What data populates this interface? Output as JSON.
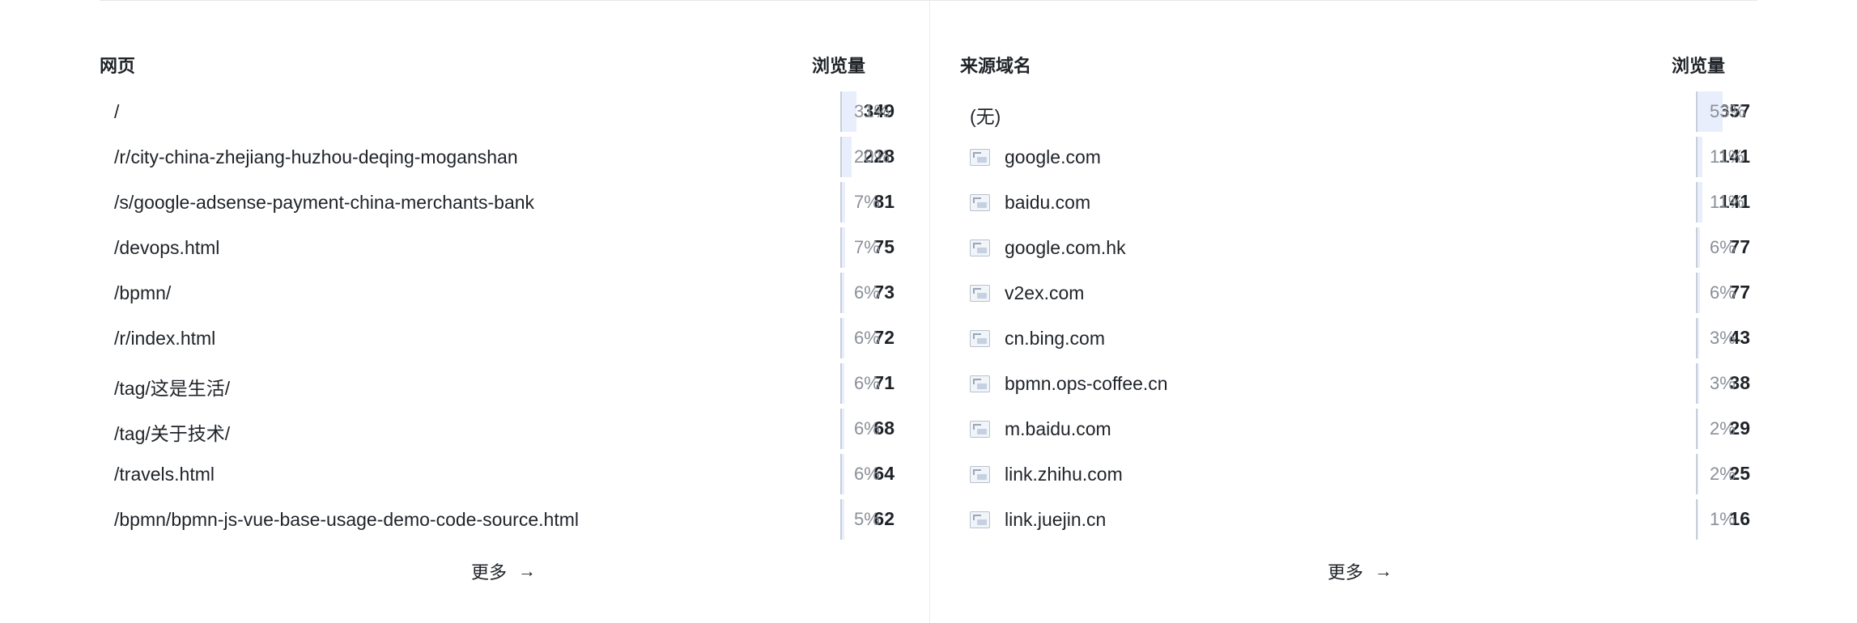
{
  "pages": {
    "title": "网页",
    "views_label": "浏览量",
    "more_label": "更多",
    "rows": [
      {
        "label": "/",
        "count": "349",
        "pct": "31%",
        "share": 0.31
      },
      {
        "label": "/r/city-china-zhejiang-huzhou-deqing-moganshan",
        "count": "228",
        "pct": "20%",
        "share": 0.2
      },
      {
        "label": "/s/google-adsense-payment-china-merchants-bank",
        "count": "81",
        "pct": "7%",
        "share": 0.07
      },
      {
        "label": "/devops.html",
        "count": "75",
        "pct": "7%",
        "share": 0.07
      },
      {
        "label": "/bpmn/",
        "count": "73",
        "pct": "6%",
        "share": 0.06
      },
      {
        "label": "/r/index.html",
        "count": "72",
        "pct": "6%",
        "share": 0.06
      },
      {
        "label": "/tag/这是生活/",
        "count": "71",
        "pct": "6%",
        "share": 0.06
      },
      {
        "label": "/tag/关于技术/",
        "count": "68",
        "pct": "6%",
        "share": 0.06
      },
      {
        "label": "/travels.html",
        "count": "64",
        "pct": "6%",
        "share": 0.06
      },
      {
        "label": "/bpmn/bpmn-js-vue-base-usage-demo-code-source.html",
        "count": "62",
        "pct": "5%",
        "share": 0.05
      }
    ]
  },
  "referrers": {
    "title": "来源域名",
    "views_label": "浏览量",
    "more_label": "更多",
    "rows": [
      {
        "label": "(无)",
        "count": "657",
        "pct": "53%",
        "share": 0.53,
        "icon": ""
      },
      {
        "label": "google.com",
        "count": "141",
        "pct": "11%",
        "share": 0.11,
        "icon": "favicon-placeholder-icon"
      },
      {
        "label": "baidu.com",
        "count": "141",
        "pct": "11%",
        "share": 0.11,
        "icon": "favicon-placeholder-icon"
      },
      {
        "label": "google.com.hk",
        "count": "77",
        "pct": "6%",
        "share": 0.06,
        "icon": "favicon-placeholder-icon"
      },
      {
        "label": "v2ex.com",
        "count": "77",
        "pct": "6%",
        "share": 0.06,
        "icon": "favicon-placeholder-icon"
      },
      {
        "label": "cn.bing.com",
        "count": "43",
        "pct": "3%",
        "share": 0.03,
        "icon": "favicon-placeholder-icon"
      },
      {
        "label": "bpmn.ops-coffee.cn",
        "count": "38",
        "pct": "3%",
        "share": 0.03,
        "icon": "favicon-placeholder-icon"
      },
      {
        "label": "m.baidu.com",
        "count": "29",
        "pct": "2%",
        "share": 0.02,
        "icon": "favicon-placeholder-icon"
      },
      {
        "label": "link.zhihu.com",
        "count": "25",
        "pct": "2%",
        "share": 0.02,
        "icon": "favicon-placeholder-icon"
      },
      {
        "label": "link.juejin.cn",
        "count": "16",
        "pct": "1%",
        "share": 0.01,
        "icon": "favicon-placeholder-icon"
      }
    ]
  },
  "colors": {
    "bar_fill": "#e8eefc",
    "bar_edge": "#c9cfd8",
    "pct_text": "#8a8f98"
  }
}
